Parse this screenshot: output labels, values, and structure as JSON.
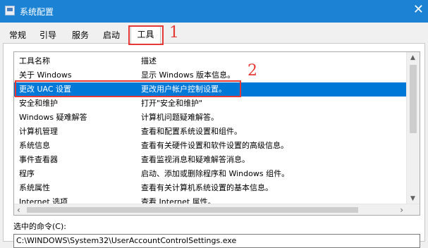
{
  "window": {
    "title": "系统配置",
    "close_glyph": "✕"
  },
  "tabs": [
    {
      "label": "常规"
    },
    {
      "label": "引导"
    },
    {
      "label": "服务"
    },
    {
      "label": "启动"
    },
    {
      "label": "工具"
    }
  ],
  "annotations": {
    "marker1": "1",
    "marker2": "2"
  },
  "tools_list": {
    "headers": {
      "name": "工具名称",
      "desc": "描述"
    },
    "rows": [
      {
        "name": "关于 Windows",
        "desc": "显示 Windows 版本信息。"
      },
      {
        "name": "更改 UAC 设置",
        "desc": "更改用户帐户控制设置。"
      },
      {
        "name": "安全和维护",
        "desc": "打开\"安全和维护\""
      },
      {
        "name": "Windows 疑难解答",
        "desc": "计算机问题疑难解答。"
      },
      {
        "name": "计算机管理",
        "desc": "查看和配置系统设置和组件。"
      },
      {
        "name": "系统信息",
        "desc": "查看有关硬件设置和软件设置的高级信息。"
      },
      {
        "name": "事件查看器",
        "desc": "查看监视消息和疑难解答消息。"
      },
      {
        "name": "程序",
        "desc": "启动、添加或删除程序和 Windows 组件。"
      },
      {
        "name": "系统属性",
        "desc": "查看有关计算机系统设置的基本信息。"
      },
      {
        "name": "Internet 选项",
        "desc": "查看 Internet 属性。"
      }
    ]
  },
  "selected_command": {
    "label": "选中的命令(C):",
    "value": "C:\\WINDOWS\\System32\\UserAccountControlSettings.exe"
  }
}
